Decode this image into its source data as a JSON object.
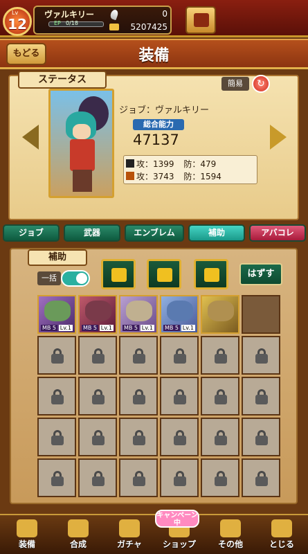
{
  "player": {
    "level_tag": "Lv",
    "level": "12",
    "name": "ヴァルキリー",
    "ep_label": "EP",
    "ep_value": "0/18",
    "ep_fraction": 0.0,
    "feather_count": "0",
    "gold": "5207425"
  },
  "header": {
    "back_label": "もどる",
    "title": "装備"
  },
  "status": {
    "tab_label": "ステータス",
    "simple_label": "簡易",
    "job": "ジョブ：ヴァルキリー",
    "power_label": "総合能力",
    "power_value": "47137",
    "stats": [
      {
        "atk": "攻：1399",
        "def": "防：479"
      },
      {
        "atk": "攻：3743",
        "def": "防：1594"
      }
    ]
  },
  "tabs": [
    "ジョブ",
    "武器",
    "エンブレム",
    "補助",
    "アバコレ"
  ],
  "support": {
    "tab_label": "補助",
    "bulk_label": "一括",
    "remove_label": "はずす",
    "cards": [
      {
        "mb": "MB 5",
        "lv": "Lv.1"
      },
      {
        "mb": "MB 5",
        "lv": "Lv.1"
      },
      {
        "mb": "MB 5",
        "lv": "Lv.1"
      },
      {
        "mb": "MB 5",
        "lv": "Lv.1"
      }
    ]
  },
  "nav": [
    "装備",
    "合成",
    "ガチャ",
    "ショップ",
    "その他",
    "とじる"
  ],
  "campaign_label": "キャンペーン中",
  "colors": {
    "tab_active": "#46d4c4",
    "tab_pink": "#e05a7a",
    "header": "#b5501c"
  }
}
